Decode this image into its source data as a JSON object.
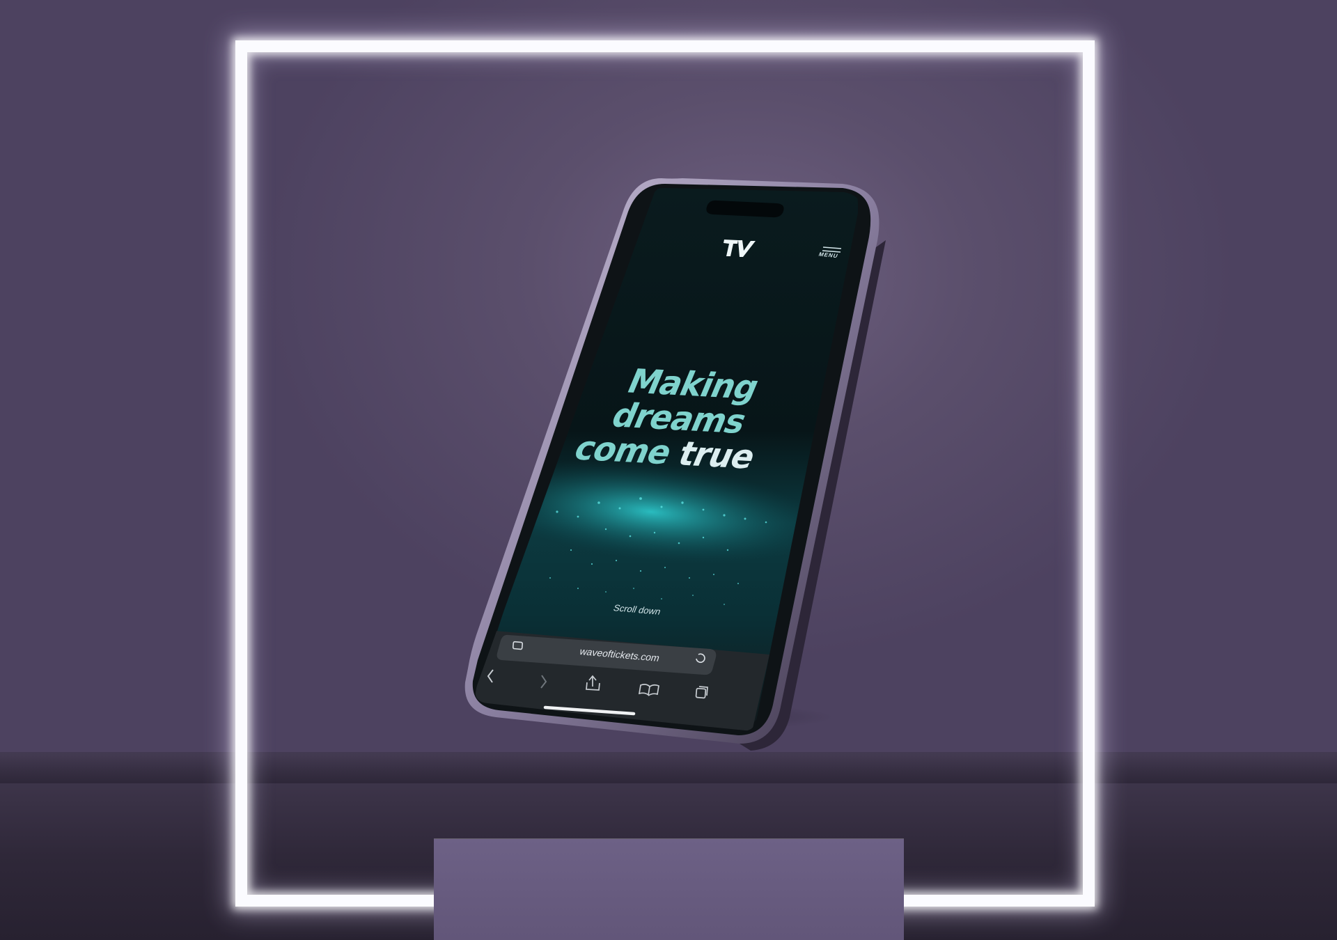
{
  "scene": {
    "background_color": "#5b4f6c",
    "neon_frame_color": "#fbfbff",
    "pedestal_color": "#675b7f"
  },
  "website": {
    "logo": "TV",
    "menu_label": "MENU",
    "headline": {
      "line1": "Making",
      "line2": "dreams",
      "line3_part1": "come",
      "line3_part2": "true"
    },
    "headline_color": "#7fd3cd",
    "accent_color": "#dceef0",
    "scroll_hint": "Scroll down"
  },
  "browser": {
    "url": "waveoftickets.com",
    "icons": {
      "page_icon": "reader-icon",
      "reload": "reload-icon",
      "back": "back-chevron-icon",
      "forward": "forward-chevron-icon",
      "share": "share-icon",
      "bookmarks": "book-icon",
      "tabs": "tabs-icon"
    }
  }
}
